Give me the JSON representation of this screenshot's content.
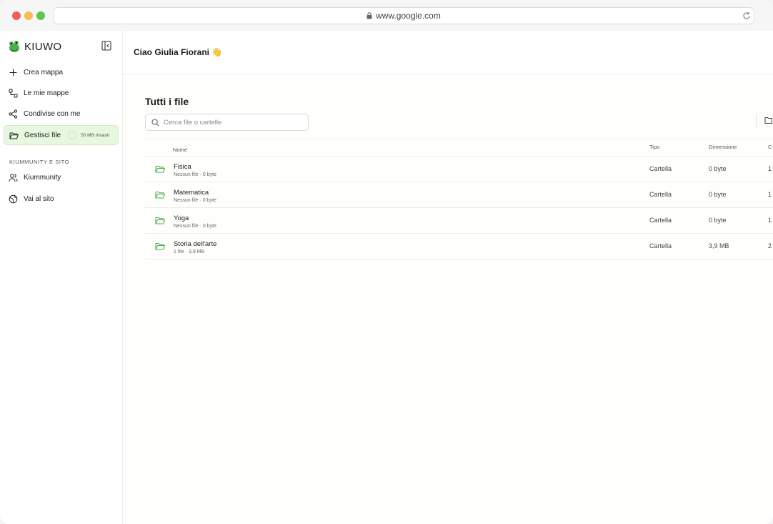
{
  "browser": {
    "url": "www.google.com"
  },
  "brand": {
    "name": "KIUWO"
  },
  "sidebar": {
    "items": [
      {
        "label": "Crea mappa",
        "icon": "plus-icon"
      },
      {
        "label": "Le mie mappe",
        "icon": "maps-icon"
      },
      {
        "label": "Condivise con me",
        "icon": "share-icon"
      },
      {
        "label": "Gestisci file",
        "icon": "folder-open-icon",
        "active": true,
        "quota": "50 MB rimasti"
      }
    ],
    "section_label": "KIUMMUNITY E SITO",
    "section_items": [
      {
        "label": "Kiummunity",
        "icon": "users-icon"
      },
      {
        "label": "Vai al sito",
        "icon": "globe-icon"
      }
    ]
  },
  "main": {
    "greeting": "Ciao Giulia Fiorani 👋",
    "title": "Tutti i file",
    "search": {
      "placeholder": "Cerca file o cartelle"
    },
    "table": {
      "headers": {
        "name": "Nome",
        "type": "Tipo",
        "size": "Dimensione",
        "extra": "C"
      },
      "rows": [
        {
          "name": "Fisica",
          "meta": "Nessun file · 0 byte",
          "type": "Cartella",
          "size": "0 byte",
          "extra": "1"
        },
        {
          "name": "Matematica",
          "meta": "Nessun file · 0 byte",
          "type": "Cartella",
          "size": "0 byte",
          "extra": "1"
        },
        {
          "name": "Yoga",
          "meta": "Nessun file · 0 byte",
          "type": "Cartella",
          "size": "0 byte",
          "extra": "1"
        },
        {
          "name": "Storia dell'arte",
          "meta": "1 file · 3,9 MB",
          "type": "Cartella",
          "size": "3,9 MB",
          "extra": "2"
        }
      ]
    }
  },
  "colors": {
    "accent": "#4caf50",
    "active_bg": "#e7f7e0"
  }
}
